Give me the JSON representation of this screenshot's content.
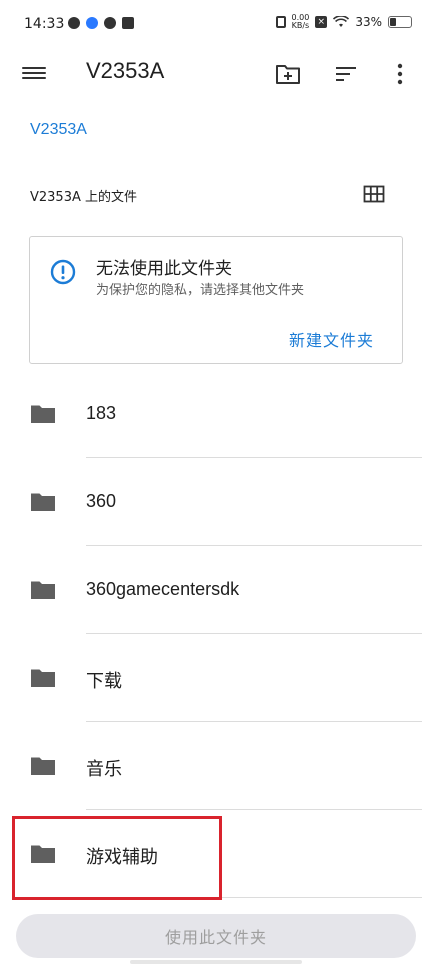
{
  "status_bar": {
    "time": "14:33",
    "net_speed_top": "0.00",
    "net_speed_bottom": "KB/s",
    "battery": "33%",
    "battery_level": 0.33
  },
  "toolbar": {
    "title": "V2353A",
    "icons": [
      "menu-icon",
      "new-folder-icon",
      "sort-icon",
      "more-vert-icon"
    ]
  },
  "breadcrumb": "V2353A",
  "section_header": "V2353A 上的文件",
  "card": {
    "title": "无法使用此文件夹",
    "subtitle": "为保护您的隐私，请选择其他文件夹",
    "action": "新建文件夹"
  },
  "folders": [
    {
      "name": "183"
    },
    {
      "name": "360"
    },
    {
      "name": "360gamecentersdk"
    },
    {
      "name": "下载"
    },
    {
      "name": "音乐"
    },
    {
      "name": "游戏辅助"
    }
  ],
  "bottom_button": "使用此文件夹",
  "colors": {
    "accent": "#1c7cd6",
    "highlight": "#d9232d",
    "folder": "#5f5f5f"
  }
}
